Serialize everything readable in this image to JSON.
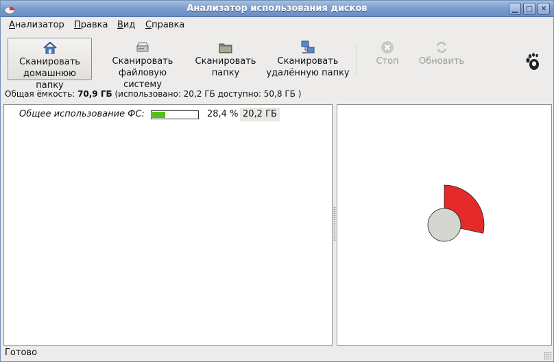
{
  "window": {
    "title": "Анализатор использования дисков",
    "min_glyph": "▁",
    "max_glyph": "□",
    "close_glyph": "✕"
  },
  "menu": [
    {
      "label_u": "А",
      "label_rest": "нализатор"
    },
    {
      "label_u": "П",
      "label_rest": "равка"
    },
    {
      "label_u": "В",
      "label_rest": "ид"
    },
    {
      "label_u": "С",
      "label_rest": "правка"
    }
  ],
  "toolbar": {
    "scan_home": {
      "label": "Сканировать\nдомашнюю папку",
      "icon": "home-icon"
    },
    "scan_fs": {
      "label": "Сканировать\nфайловую систему",
      "icon": "harddisk-icon"
    },
    "scan_folder": {
      "label": "Сканировать\nпапку",
      "icon": "folder-icon"
    },
    "scan_remote": {
      "label": "Сканировать\nудалённую папку",
      "icon": "network-icon"
    },
    "stop": {
      "label": "Стоп",
      "icon": "stop-icon",
      "enabled": false
    },
    "refresh": {
      "label": "Обновить",
      "icon": "refresh-icon",
      "enabled": false
    },
    "gnome_icon": "gnome-foot-icon"
  },
  "capacity": {
    "prefix": "Общая ёмкость: ",
    "total": "70,9 ГБ",
    "details": " (использовано: 20,2 ГБ доступно: 50,8 ГБ )"
  },
  "tree": {
    "rows": [
      {
        "label": "Общее использование ФС:",
        "usage_fraction": 0.284,
        "percent": "28,4 %",
        "size": "20,2 ГБ"
      }
    ]
  },
  "ring_chart": {
    "center_color": "#d3d7cf",
    "segment_color": "#e52a2a",
    "segment_fraction": 0.284
  },
  "status": "Готово",
  "colors": {
    "titlebar": "#7a9ccc",
    "usage_bar": "#4fc219"
  }
}
